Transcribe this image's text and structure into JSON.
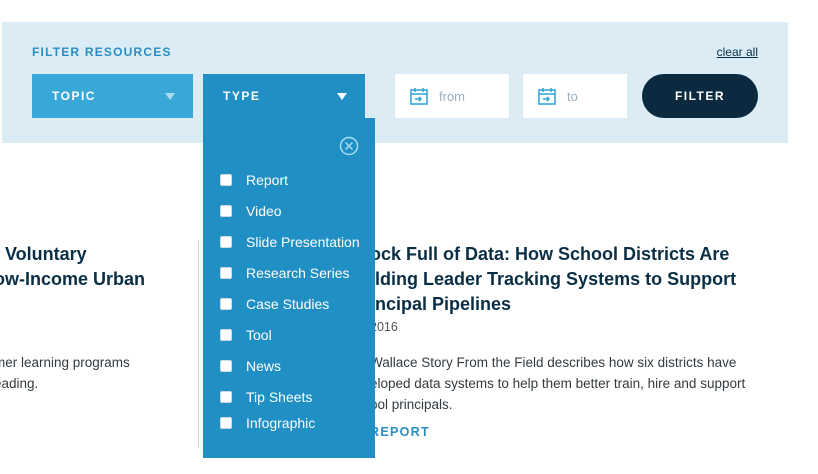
{
  "filter": {
    "title": "FILTER RESOURCES",
    "clear_all": "clear all",
    "topic_label": "TOPIC",
    "type_label": "TYPE",
    "from_placeholder": "from",
    "to_placeholder": "to",
    "filter_button": "FILTER"
  },
  "type_dropdown": {
    "options": [
      "Report",
      "Video",
      "Slide Presentation",
      "Research Series",
      "Case Studies",
      "Tool",
      "News",
      "Tip Sheets",
      "Infographic"
    ]
  },
  "cards": [
    {
      "title": "f Voluntary\now-Income Urban",
      "description": "mer learning programs\neading."
    },
    {
      "title": "ock Full of Data: How School Districts Are\nilding Leader Tracking Systems to Support\nincipal Pipelines",
      "date": "2016",
      "description": "Wallace Story From the Field describes how six districts have\neloped data systems to help them better train, hire and support\nool principals.",
      "tag": "REPORT"
    }
  ],
  "colors": {
    "panel_bg": "#dcecf5",
    "accent": "#2a8ec4",
    "topic_bg": "#3aa7d9",
    "type_bg": "#1f8fc4",
    "button_bg": "#0b2a40"
  }
}
